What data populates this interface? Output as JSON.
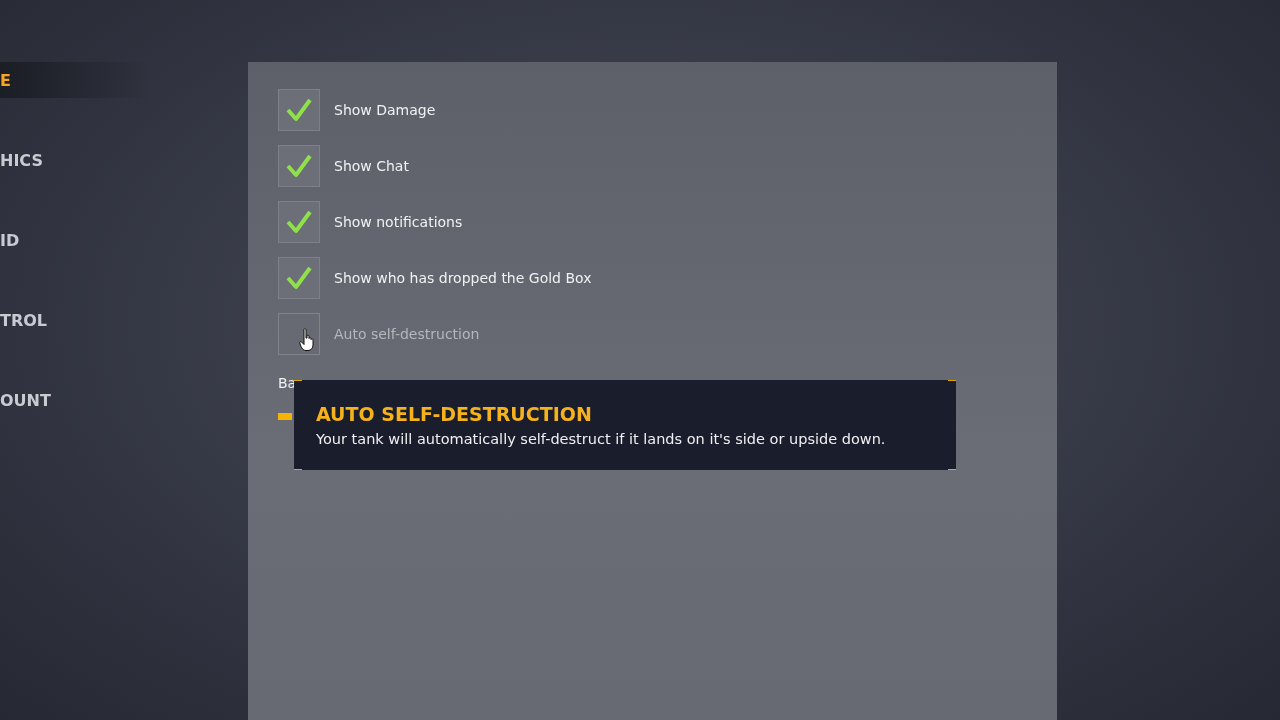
{
  "sidebar": {
    "items": [
      {
        "label": "E",
        "selected": true
      },
      {
        "label": "HICS",
        "selected": false
      },
      {
        "label": "ID",
        "selected": false
      },
      {
        "label": "TROL",
        "selected": false
      },
      {
        "label": "OUNT",
        "selected": false
      }
    ]
  },
  "settings": {
    "checkboxes": [
      {
        "label": "Show Damage",
        "checked": true,
        "disabled": false
      },
      {
        "label": "Show Chat",
        "checked": true,
        "disabled": false
      },
      {
        "label": "Show notifications",
        "checked": true,
        "disabled": false
      },
      {
        "label": "Show who has dropped the Gold Box",
        "checked": true,
        "disabled": false
      },
      {
        "label": "Auto self-destruction",
        "checked": false,
        "disabled": true
      }
    ],
    "slider_label": "Ba"
  },
  "tooltip": {
    "title": "AUTO SELF-DESTRUCTION",
    "text": "Your tank will automatically self-destruct if it lands on it's side or upside down."
  }
}
